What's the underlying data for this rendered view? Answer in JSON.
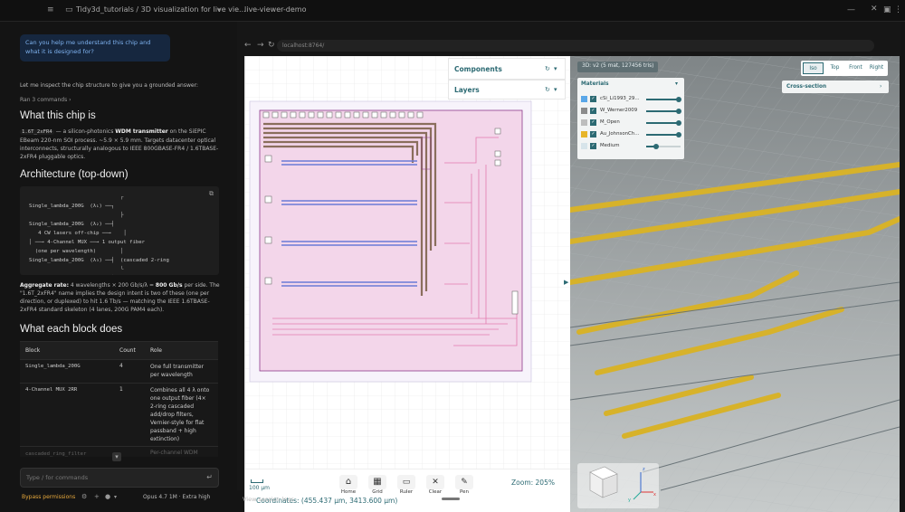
{
  "topbar": {
    "breadcrumb": "Tidy3d_tutorials / 3D visualization for live vie...",
    "browser_tab": "live-viewer-demo"
  },
  "chat": {
    "user_prompt": "Can you help me understand this chip and what it is designed for?",
    "intro": "Let me inspect the chip structure to give you a grounded answer:",
    "ran_commands": "Ran 3 commands ›",
    "h_what": "What this chip is",
    "chip_name": "1.6T_2xFR4",
    "chip_desc_1": " — a silicon-photonics ",
    "chip_desc_bold": "WDM transmitter",
    "chip_desc_2": " on the SiEPIC EBeam 220-nm SOI process. ~5.9 × 5.9 mm. Targets datacenter optical interconnects, structurally analogous to IEEE 800GBASE-FR4 / 1.6TBASE-2xFR4 pluggable optics.",
    "h_arch": "Architecture (top-down)",
    "arch_lines": [
      "                              ┌",
      "Single_lambda_200G  (λ₁) ──┐   ",
      "                              ├",
      "Single_lambda_200G  (λ₂) ──┤",
      "   4 CW lasers off-chip ──→    │",
      "│ ──→ 4-Channel MUX ──→ 1 output fiber",
      "  (one per wavelength)        │",
      "Single_lambda_200G  (λ₃) ──┤  (cascaded 2-ring",
      "                              └",
      "Single_lambda_200G  (λ₄) ──┘   add/drop filters)"
    ],
    "aggregate_label": "Aggregate rate:",
    "aggregate_text": " 4 wavelengths × 200 Gb/s/λ = ",
    "aggregate_bold": "800 Gb/s",
    "aggregate_text2": " per side. The \"1.6T_2xFR4\" name implies the design intent is two of these (one per direction, or duplexed) to hit 1.6 Tb/s — matching the IEEE 1.6TBASE-2xFR4 standard skeleton (4 lanes, 200G PAM4 each).",
    "h_blocks": "What each block does",
    "table_headers": [
      "Block",
      "Count",
      "Role"
    ],
    "table_rows": [
      {
        "block": "Single_lambda_200G",
        "count": "4",
        "role": "One full transmitter per wavelength"
      },
      {
        "block": "4-Channel MUX 2RR",
        "count": "1",
        "role": "Combines all 4 λ onto one output fiber (4× 2-ring cascaded add/drop filters, Vernier-style for flat passband + high extinction)"
      },
      {
        "block": "cascaded_ring_filter",
        "count": "",
        "role": "Per-channel WDM"
      }
    ],
    "input_placeholder": "Type / for commands",
    "bypass": "Bypass permissions",
    "model": "Opus 4.7 1M · Extra high"
  },
  "browser": {
    "url": "localhost:8764/",
    "view_logs": "View session logs",
    "sidebar_components": "Components",
    "sidebar_layers": "Layers",
    "tools": [
      {
        "label": "Home",
        "icon": "home-icon"
      },
      {
        "label": "Grid",
        "icon": "grid-icon"
      },
      {
        "label": "Ruler",
        "icon": "ruler-icon"
      },
      {
        "label": "Clear",
        "icon": "close-icon"
      },
      {
        "label": "Pen",
        "icon": "pen-icon"
      }
    ],
    "scale_label": "100 µm",
    "zoom": "Zoom: 205%",
    "coordinates": "Coordinates: (455.437 µm, 3413.600 µm)"
  },
  "viewer3d": {
    "status": "3D: v2 (5 mat, 127456 tris)",
    "views": [
      "Iso",
      "Top",
      "Front",
      "Right"
    ],
    "materials_title": "Materials",
    "materials": [
      {
        "name": "cSi_Li1993_29...",
        "color": "#5aa7e8",
        "level": 0.95
      },
      {
        "name": "W_Werner2009",
        "color": "#8b8b8b",
        "level": 0.95
      },
      {
        "name": "M_Open",
        "color": "#bdbdbd",
        "level": 0.95
      },
      {
        "name": "Au_JohnsonCh...",
        "color": "#e7b52a",
        "level": 0.95
      },
      {
        "name": "Medium",
        "color": "#d7e4ea",
        "level": 0.3
      }
    ],
    "cross_section": "Cross-section",
    "axis_x": "x",
    "axis_y": "y",
    "axis_z": "z"
  }
}
